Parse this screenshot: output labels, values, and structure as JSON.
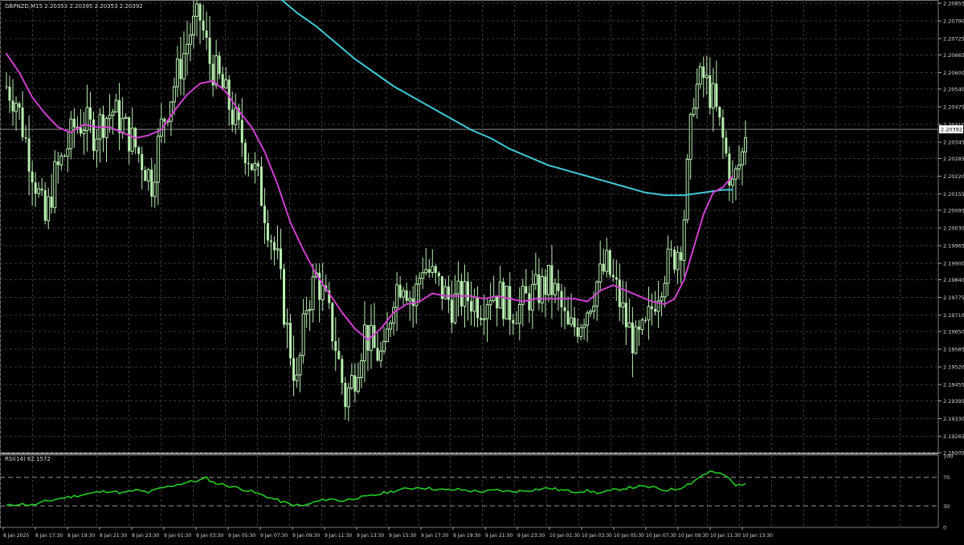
{
  "header": {
    "symbol_info": "GBPNZD,M15  2.20353 2.20395 2.20353 2.20392",
    "rsi_label": "RSI(14) 62.1572"
  },
  "colors": {
    "background": "#000000",
    "grid": "#3a3a3a",
    "candle": "#b8f0b0",
    "ma_fast": "#d040d0",
    "ma_slow": "#40c8d8",
    "rsi": "#22cc22",
    "text": "#d8d8d8"
  },
  "chart_data": [
    {
      "type": "line",
      "name": "price",
      "title": "GBPNZD,M15",
      "ylim": [
        2.19205,
        2.20855
      ],
      "y_ticks": [
        "2.20855",
        "2.20790",
        "2.20725",
        "2.20665",
        "2.20600",
        "2.20540",
        "2.20475",
        "2.20410",
        "2.20345",
        "2.20285",
        "2.20220",
        "2.20155",
        "2.20095",
        "2.20030",
        "2.19965",
        "2.19900",
        "2.19840",
        "2.19775",
        "2.19710",
        "2.19650",
        "2.19585",
        "2.19520",
        "2.19455",
        "2.19395",
        "2.19330",
        "2.19265",
        "2.19205"
      ],
      "current_price": "2.20392",
      "x_tick_labels": [
        "8 Jan 2025",
        "8 Jan 17:30",
        "8 Jan 19:30",
        "8 Jan 21:30",
        "8 Jan 23:30",
        "9 Jan 01:30",
        "9 Jan 03:30",
        "9 Jan 05:30",
        "9 Jan 07:30",
        "9 Jan 09:30",
        "9 Jan 11:30",
        "9 Jan 13:30",
        "9 Jan 15:30",
        "9 Jan 17:30",
        "9 Jan 19:30",
        "9 Jan 21:30",
        "9 Jan 23:30",
        "10 Jan 01:30",
        "10 Jan 03:30",
        "10 Jan 05:30",
        "10 Jan 07:30",
        "10 Jan 09:30",
        "10 Jan 11:30",
        "10 Jan 13:30"
      ],
      "close_path": [
        [
          0,
          2.2055
        ],
        [
          3,
          2.205
        ],
        [
          6,
          2.2035
        ],
        [
          9,
          2.202
        ],
        [
          12,
          2.2005
        ],
        [
          15,
          2.2022
        ],
        [
          18,
          2.203
        ],
        [
          21,
          2.204
        ],
        [
          24,
          2.2042
        ],
        [
          27,
          2.2038
        ],
        [
          30,
          2.2043
        ],
        [
          33,
          2.2046
        ],
        [
          36,
          2.2041
        ],
        [
          39,
          2.2035
        ],
        [
          42,
          2.2028
        ],
        [
          45,
          2.202
        ],
        [
          48,
          2.204
        ],
        [
          51,
          2.2052
        ],
        [
          54,
          2.2063
        ],
        [
          57,
          2.2075
        ],
        [
          60,
          2.208
        ],
        [
          63,
          2.2064
        ],
        [
          66,
          2.2057
        ],
        [
          69,
          2.2048
        ],
        [
          72,
          2.2038
        ],
        [
          75,
          2.203
        ],
        [
          78,
          2.202
        ],
        [
          81,
          2.2005
        ],
        [
          84,
          2.199
        ],
        [
          87,
          2.1965
        ],
        [
          90,
          2.1945
        ],
        [
          93,
          2.1975
        ],
        [
          96,
          2.1985
        ],
        [
          99,
          2.1975
        ],
        [
          102,
          2.196
        ],
        [
          105,
          2.194
        ],
        [
          108,
          2.195
        ],
        [
          111,
          2.1965
        ],
        [
          114,
          2.1958
        ],
        [
          117,
          2.1955
        ],
        [
          120,
          2.198
        ],
        [
          123,
          2.1985
        ],
        [
          126,
          2.1975
        ],
        [
          129,
          2.199
        ],
        [
          132,
          2.1985
        ],
        [
          135,
          2.198
        ],
        [
          138,
          2.1975
        ],
        [
          141,
          2.1978
        ],
        [
          144,
          2.1977
        ],
        [
          147,
          2.1975
        ],
        [
          150,
          2.198
        ],
        [
          153,
          2.1978
        ],
        [
          156,
          2.1973
        ],
        [
          159,
          2.1974
        ],
        [
          162,
          2.1978
        ],
        [
          165,
          2.198
        ],
        [
          168,
          2.1983
        ],
        [
          171,
          2.1977
        ],
        [
          174,
          2.1965
        ],
        [
          177,
          2.1968
        ],
        [
          180,
          2.1974
        ],
        [
          183,
          2.1983
        ],
        [
          186,
          2.1989
        ],
        [
          189,
          2.198
        ],
        [
          192,
          2.1968
        ],
        [
          195,
          2.196
        ],
        [
          198,
          2.1965
        ],
        [
          201,
          2.1978
        ],
        [
          204,
          2.1988
        ],
        [
          207,
          2.1993
        ],
        [
          209,
          2.1998
        ],
        [
          210,
          2.2008
        ],
        [
          213,
          2.2053
        ],
        [
          216,
          2.2058
        ],
        [
          219,
          2.205
        ],
        [
          222,
          2.2035
        ],
        [
          225,
          2.2018
        ],
        [
          228,
          2.203
        ],
        [
          229,
          2.2039
        ]
      ],
      "ma_fast": [
        [
          0,
          2.2067
        ],
        [
          4,
          2.206
        ],
        [
          8,
          2.2051
        ],
        [
          12,
          2.2045
        ],
        [
          16,
          2.204
        ],
        [
          20,
          2.2038
        ],
        [
          24,
          2.2041
        ],
        [
          28,
          2.204
        ],
        [
          32,
          2.204
        ],
        [
          36,
          2.2038
        ],
        [
          40,
          2.2036
        ],
        [
          44,
          2.2037
        ],
        [
          48,
          2.2039
        ],
        [
          52,
          2.2046
        ],
        [
          56,
          2.2052
        ],
        [
          60,
          2.2056
        ],
        [
          64,
          2.2057
        ],
        [
          68,
          2.2053
        ],
        [
          72,
          2.2046
        ],
        [
          76,
          2.204
        ],
        [
          80,
          2.2031
        ],
        [
          84,
          2.2019
        ],
        [
          88,
          2.2005
        ],
        [
          92,
          2.1995
        ],
        [
          96,
          2.1986
        ],
        [
          100,
          2.1979
        ],
        [
          104,
          2.1972
        ],
        [
          108,
          2.1966
        ],
        [
          112,
          2.1962
        ],
        [
          116,
          2.1966
        ],
        [
          120,
          2.1972
        ],
        [
          124,
          2.1975
        ],
        [
          128,
          2.1976
        ],
        [
          132,
          2.1979
        ],
        [
          136,
          2.1978
        ],
        [
          140,
          2.1978
        ],
        [
          144,
          2.1978
        ],
        [
          148,
          2.1977
        ],
        [
          152,
          2.1978
        ],
        [
          156,
          2.1977
        ],
        [
          160,
          2.1976
        ],
        [
          164,
          2.1977
        ],
        [
          168,
          2.1977
        ],
        [
          172,
          2.1977
        ],
        [
          176,
          2.1977
        ],
        [
          180,
          2.1976
        ],
        [
          184,
          2.198
        ],
        [
          188,
          2.1982
        ],
        [
          192,
          2.198
        ],
        [
          196,
          2.1978
        ],
        [
          200,
          2.1976
        ],
        [
          204,
          2.1975
        ],
        [
          207,
          2.1977
        ],
        [
          210,
          2.1984
        ],
        [
          213,
          2.1996
        ],
        [
          216,
          2.2008
        ],
        [
          219,
          2.2016
        ],
        [
          222,
          2.2018
        ],
        [
          225,
          2.2022
        ]
      ],
      "ma_slow": [
        [
          84,
          2.2088
        ],
        [
          90,
          2.2082
        ],
        [
          96,
          2.2077
        ],
        [
          102,
          2.2071
        ],
        [
          108,
          2.2065
        ],
        [
          114,
          2.206
        ],
        [
          120,
          2.2055
        ],
        [
          126,
          2.2051
        ],
        [
          132,
          2.2047
        ],
        [
          138,
          2.2043
        ],
        [
          144,
          2.2039
        ],
        [
          150,
          2.2036
        ],
        [
          156,
          2.2032
        ],
        [
          162,
          2.2029
        ],
        [
          168,
          2.2026
        ],
        [
          174,
          2.2024
        ],
        [
          180,
          2.2022
        ],
        [
          186,
          2.202
        ],
        [
          192,
          2.2018
        ],
        [
          198,
          2.2016
        ],
        [
          204,
          2.2015
        ],
        [
          210,
          2.2015
        ],
        [
          216,
          2.2016
        ],
        [
          222,
          2.2017
        ],
        [
          225,
          2.2017
        ]
      ]
    },
    {
      "type": "line",
      "name": "RSI(14)",
      "title": "RSI(14) 62.1572",
      "ylim": [
        0,
        100
      ],
      "y_ticks": [
        "100",
        "70",
        "30",
        "0"
      ],
      "levels": [
        70,
        30
      ],
      "values": [
        [
          0,
          30
        ],
        [
          4,
          33
        ],
        [
          8,
          31
        ],
        [
          12,
          36
        ],
        [
          16,
          40
        ],
        [
          20,
          43
        ],
        [
          24,
          46
        ],
        [
          28,
          49
        ],
        [
          32,
          51
        ],
        [
          36,
          48
        ],
        [
          40,
          52
        ],
        [
          44,
          49
        ],
        [
          48,
          55
        ],
        [
          52,
          59
        ],
        [
          56,
          63
        ],
        [
          60,
          66
        ],
        [
          62,
          69
        ],
        [
          64,
          63
        ],
        [
          68,
          59
        ],
        [
          72,
          55
        ],
        [
          76,
          50
        ],
        [
          80,
          44
        ],
        [
          84,
          38
        ],
        [
          88,
          32
        ],
        [
          92,
          30
        ],
        [
          96,
          36
        ],
        [
          100,
          40
        ],
        [
          104,
          37
        ],
        [
          108,
          41
        ],
        [
          112,
          43
        ],
        [
          116,
          47
        ],
        [
          120,
          51
        ],
        [
          124,
          54
        ],
        [
          128,
          56
        ],
        [
          132,
          54
        ],
        [
          136,
          52
        ],
        [
          140,
          53
        ],
        [
          144,
          51
        ],
        [
          148,
          50
        ],
        [
          152,
          52
        ],
        [
          156,
          50
        ],
        [
          160,
          51
        ],
        [
          164,
          53
        ],
        [
          168,
          55
        ],
        [
          172,
          52
        ],
        [
          176,
          50
        ],
        [
          180,
          51
        ],
        [
          184,
          48
        ],
        [
          188,
          52
        ],
        [
          192,
          55
        ],
        [
          196,
          57
        ],
        [
          200,
          56
        ],
        [
          204,
          52
        ],
        [
          208,
          54
        ],
        [
          212,
          62
        ],
        [
          216,
          74
        ],
        [
          218,
          78
        ],
        [
          220,
          76
        ],
        [
          223,
          72
        ],
        [
          226,
          58
        ],
        [
          229,
          62
        ]
      ]
    }
  ]
}
